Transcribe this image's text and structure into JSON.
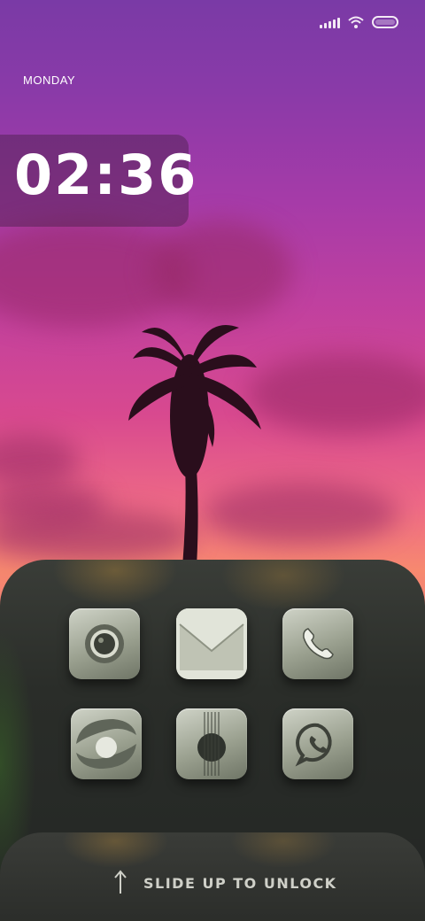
{
  "status_bar": {
    "icons": [
      "signal-icon",
      "wifi-icon",
      "battery-icon"
    ]
  },
  "clock": {
    "time": "02:36",
    "day": "MONDAY"
  },
  "apps": [
    {
      "name": "camera",
      "icon": "camera-icon"
    },
    {
      "name": "mail",
      "icon": "envelope-icon"
    },
    {
      "name": "phone",
      "icon": "phone-icon"
    },
    {
      "name": "browser",
      "icon": "globe-icon"
    },
    {
      "name": "music",
      "icon": "guitar-icon"
    },
    {
      "name": "whatsapp",
      "icon": "whatsapp-icon"
    }
  ],
  "unlock": {
    "label": "SLIDE UP TO UNLOCK",
    "icon": "arrow-up-icon"
  },
  "colors": {
    "sky_top": "#7a3aa6",
    "sky_glow": "#f7896f",
    "dock": "#2a2d29",
    "icon_face": "#aeb3a3"
  }
}
